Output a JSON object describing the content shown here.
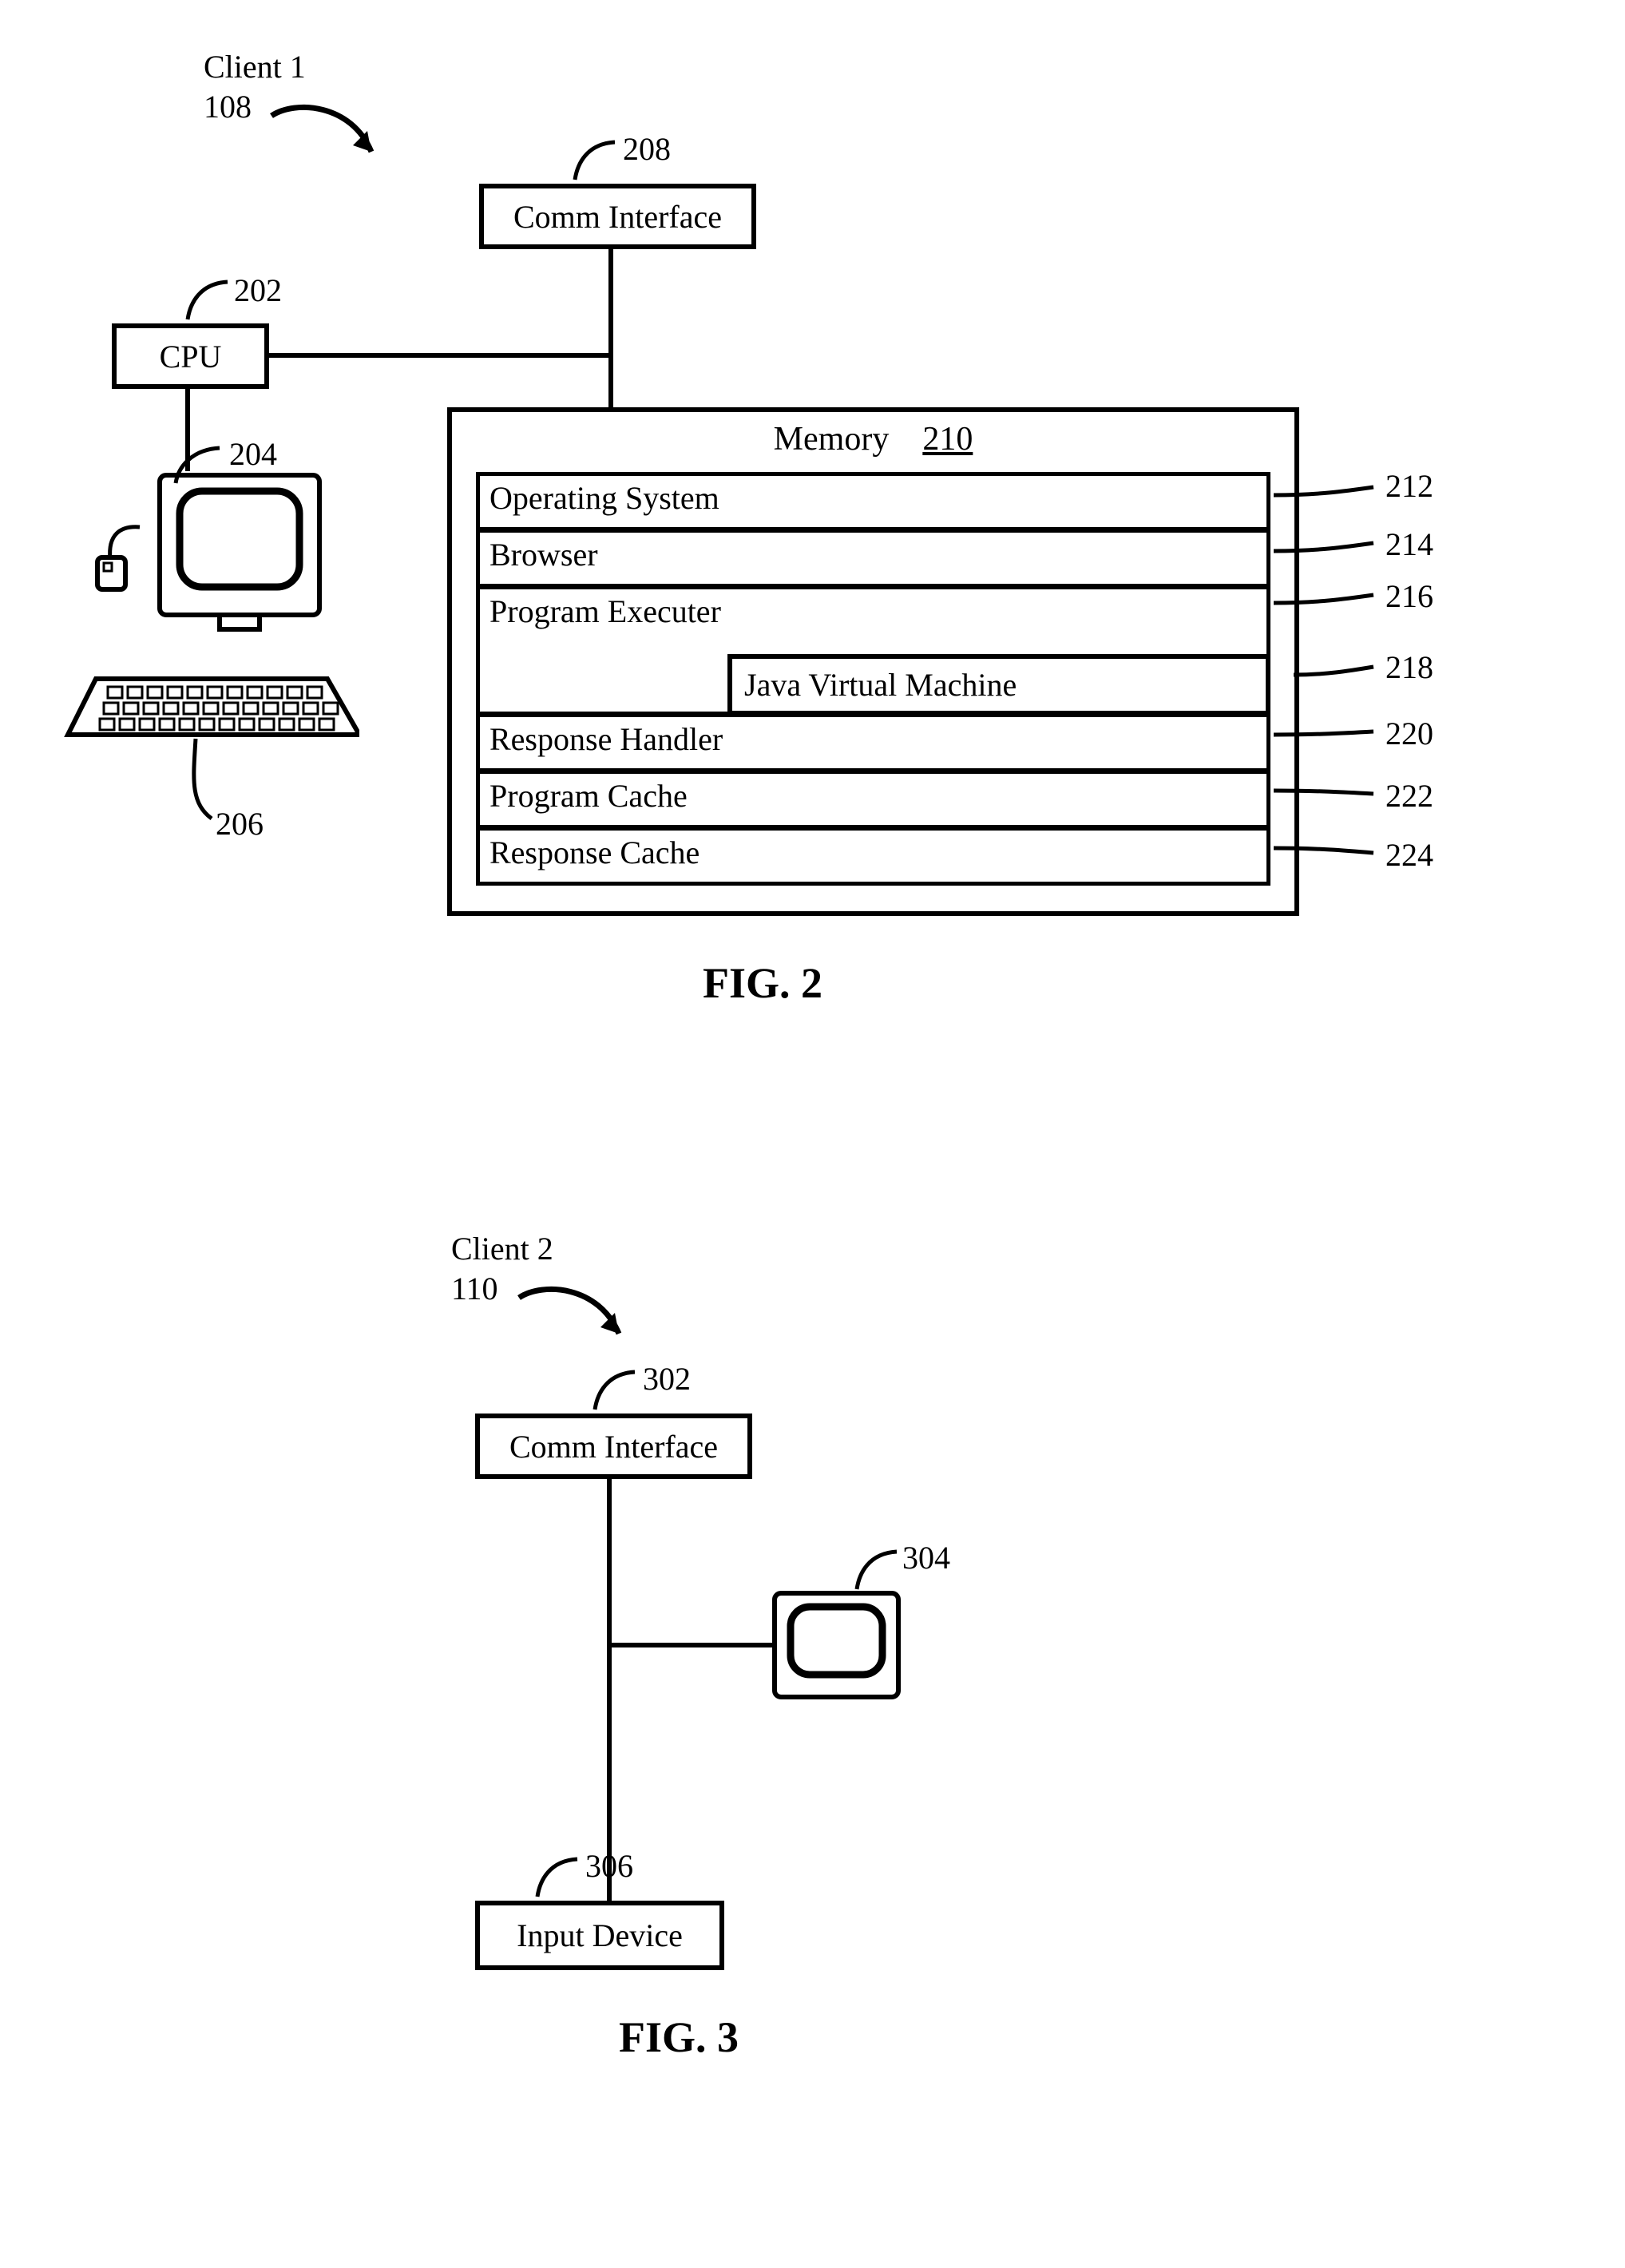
{
  "fig2": {
    "title_line1": "Client 1",
    "title_line2": "108",
    "cpu": {
      "label": "CPU",
      "ref": "202"
    },
    "terminal_ref": "204",
    "keyboard_ref": "206",
    "comm": {
      "label": "Comm Interface",
      "ref": "208"
    },
    "memory": {
      "title": "Memory",
      "ref": "210",
      "rows": [
        {
          "label": "Operating System",
          "ref": "212"
        },
        {
          "label": "Browser",
          "ref": "214"
        },
        {
          "label": "Program Executer",
          "ref": "216"
        },
        {
          "label": "Java Virtual Machine",
          "ref": "218"
        },
        {
          "label": "Response Handler",
          "ref": "220"
        },
        {
          "label": "Program Cache",
          "ref": "222"
        },
        {
          "label": "Response Cache",
          "ref": "224"
        }
      ]
    },
    "caption": "FIG. 2"
  },
  "fig3": {
    "title_line1": "Client 2",
    "title_line2": "110",
    "comm": {
      "label": "Comm Interface",
      "ref": "302"
    },
    "monitor_ref": "304",
    "input": {
      "label": "Input Device",
      "ref": "306"
    },
    "caption": "FIG. 3"
  }
}
